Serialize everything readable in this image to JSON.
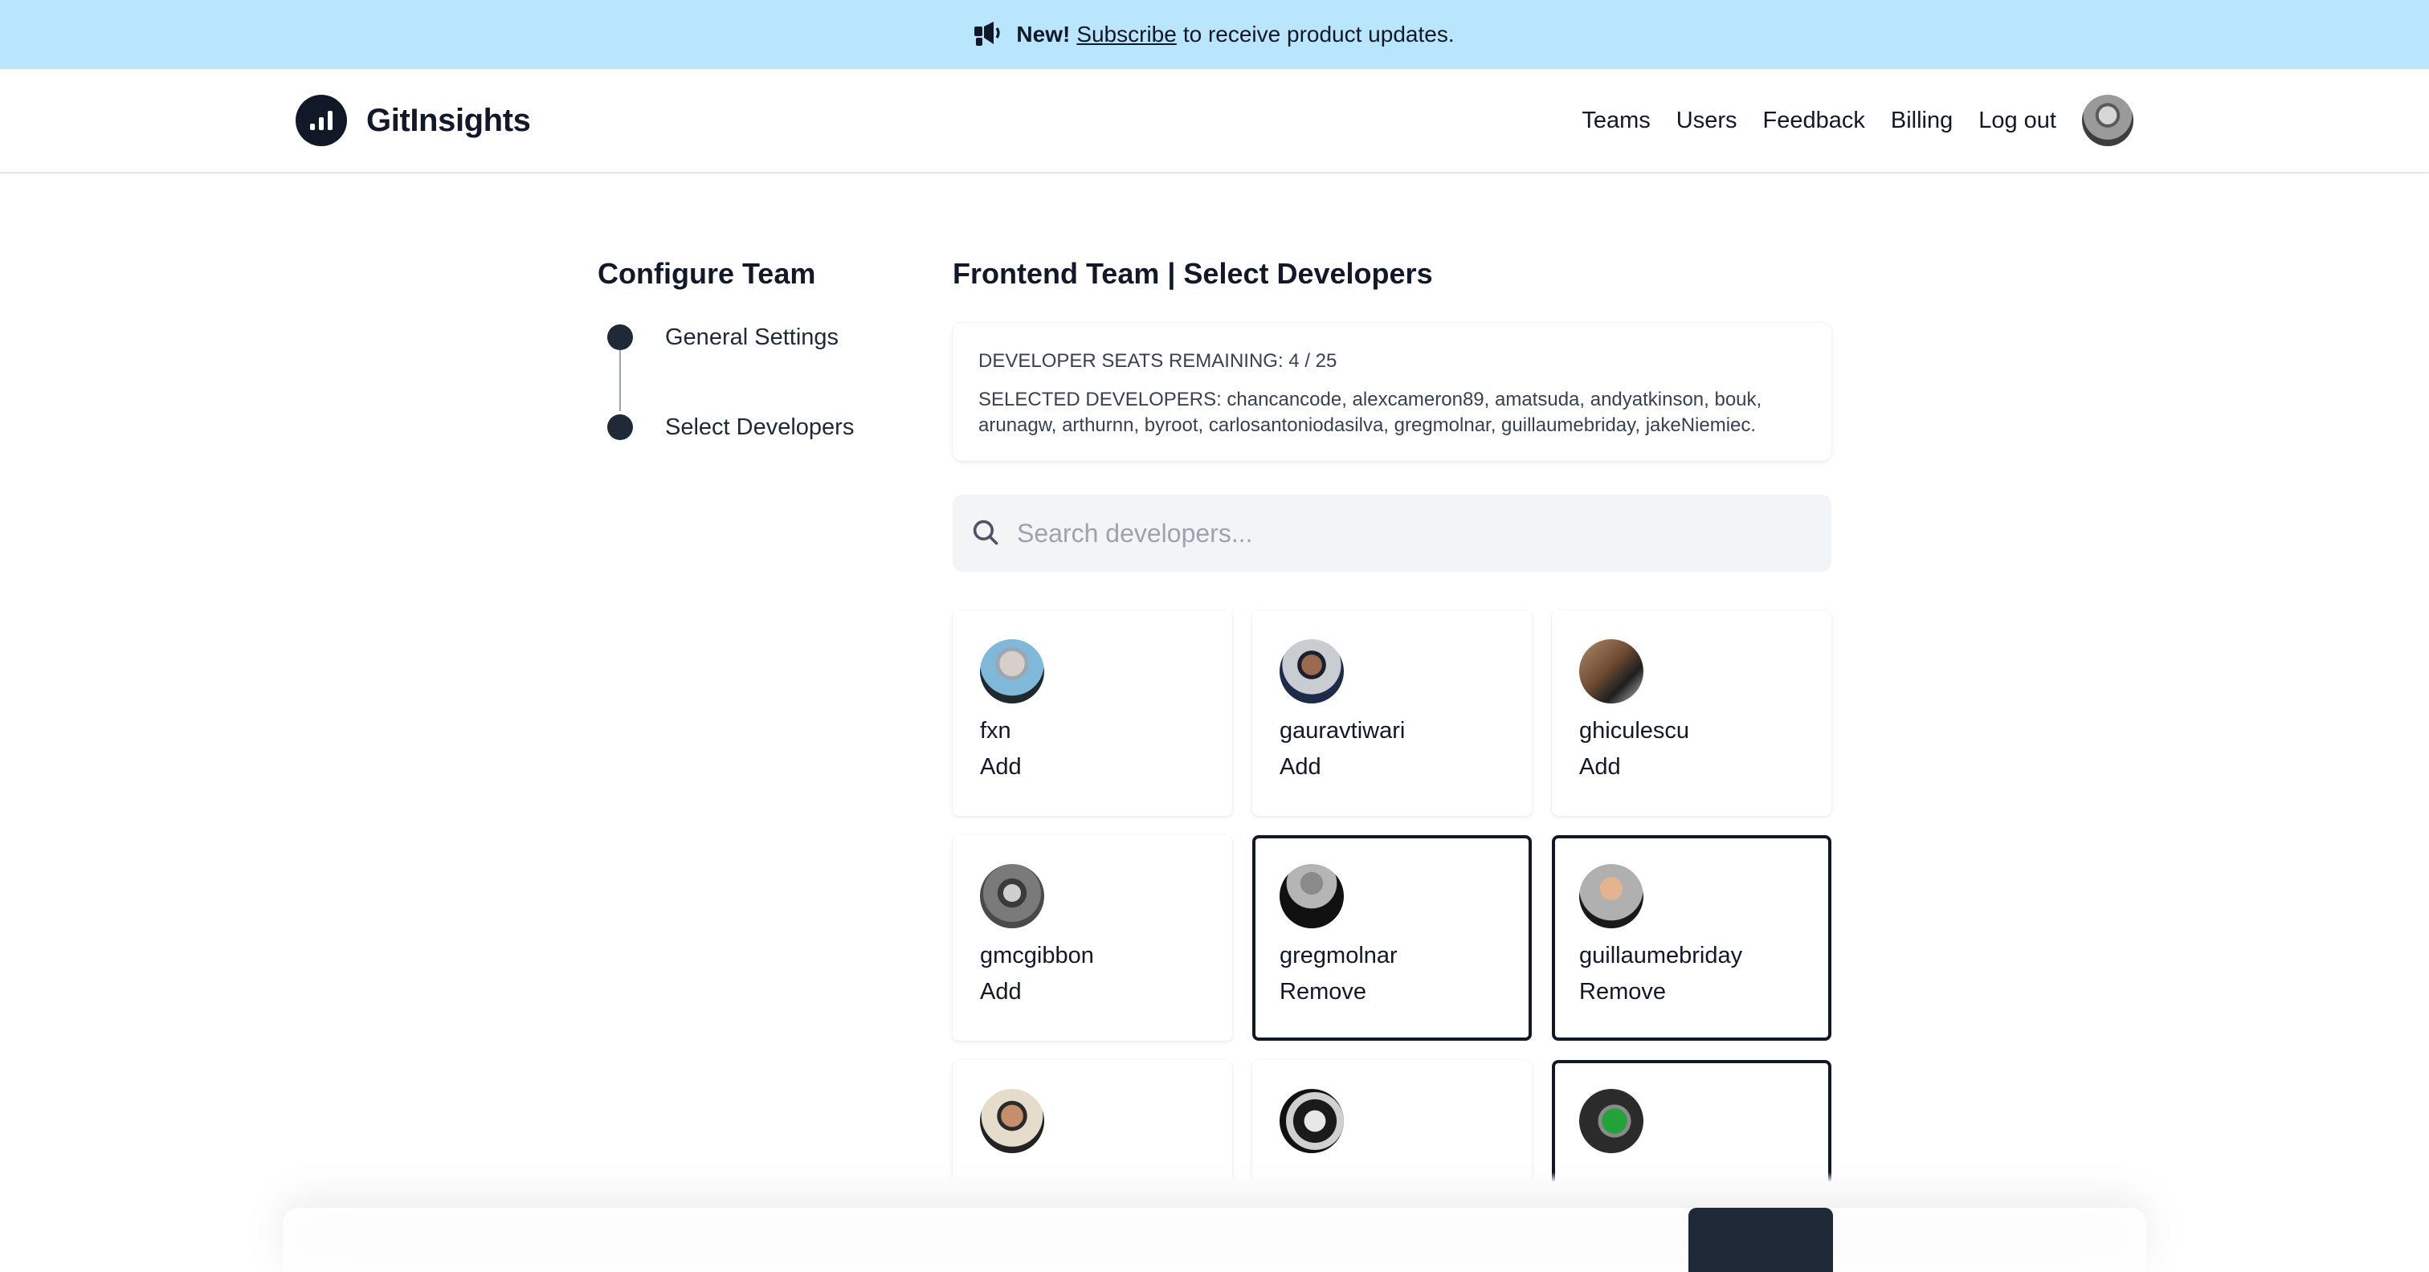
{
  "banner": {
    "icon": "megaphone-icon",
    "new_label": "New!",
    "link_label": "Subscribe",
    "rest_text": "to receive product updates."
  },
  "header": {
    "brand_name": "GitInsights",
    "nav": [
      "Teams",
      "Users",
      "Feedback",
      "Billing",
      "Log out"
    ]
  },
  "sidebar": {
    "title": "Configure Team",
    "steps": [
      "General Settings",
      "Select Developers"
    ]
  },
  "content": {
    "title": "Frontend Team | Select Developers",
    "seats_text": "DEVELOPER SEATS REMAINING: 4 / 25",
    "selected_text": "SELECTED DEVELOPERS: chancancode, alexcameron89, amatsuda, andyatkinson, bouk, arunagw, arthurnn, byroot, carlosantoniodasilva, gregmolnar, guillaumebriday, jakeNiemiec.",
    "search_placeholder": "Search developers...",
    "developers": [
      {
        "name": "fxn",
        "action": "Add",
        "selected": false
      },
      {
        "name": "gauravtiwari",
        "action": "Add",
        "selected": false
      },
      {
        "name": "ghiculescu",
        "action": "Add",
        "selected": false
      },
      {
        "name": "gmcgibbon",
        "action": "Add",
        "selected": false
      },
      {
        "name": "gregmolnar",
        "action": "Remove",
        "selected": true
      },
      {
        "name": "guillaumebriday",
        "action": "Remove",
        "selected": true
      },
      {
        "name": "",
        "action": "",
        "selected": false
      },
      {
        "name": "",
        "action": "",
        "selected": false
      },
      {
        "name": "",
        "action": "",
        "selected": true
      }
    ]
  },
  "colors": {
    "banner_bg": "#bae6fd",
    "primary": "#111827",
    "step_dot": "#1f2937"
  }
}
